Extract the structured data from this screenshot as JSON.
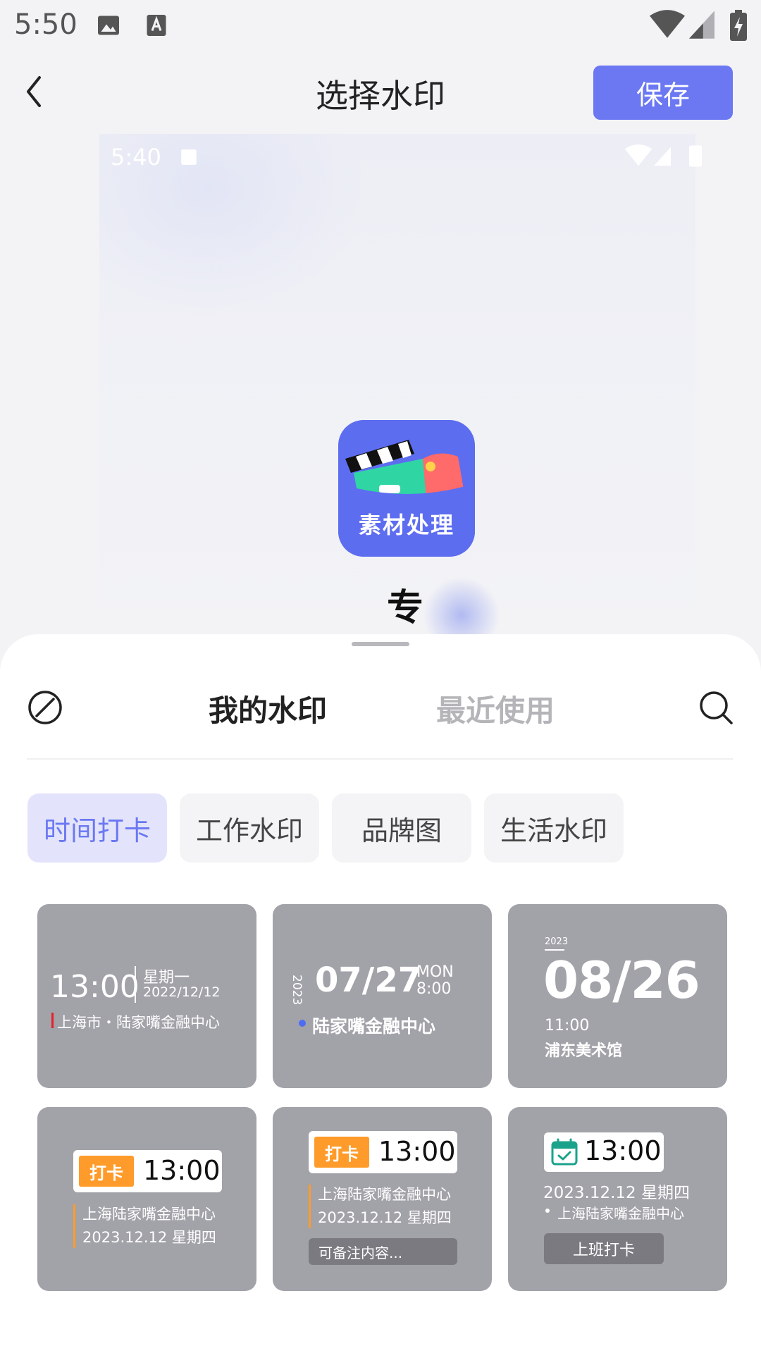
{
  "status_bar": {
    "time": "5:50"
  },
  "header": {
    "title": "选择水印",
    "save_label": "保存"
  },
  "preview": {
    "status_time": "5:40",
    "app_name": "素材处理",
    "text_fragment": "专"
  },
  "sheet": {
    "tabs": [
      {
        "label": "我的水印",
        "active": true
      },
      {
        "label": "最近使用",
        "active": false
      }
    ],
    "categories": [
      {
        "label": "时间打卡",
        "active": true
      },
      {
        "label": "工作水印",
        "active": false
      },
      {
        "label": "品牌图",
        "active": false
      },
      {
        "label": "生活水印",
        "active": false
      }
    ],
    "cards": {
      "c1": {
        "time": "13:00",
        "weekday": "星期一",
        "date": "2022/12/12",
        "location": "上海市・陆家嘴金融中心"
      },
      "c2": {
        "year": "2023",
        "date": "07/27",
        "day": "MON",
        "time": "8:00",
        "location": "陆家嘴金融中心"
      },
      "c3": {
        "year": "2023",
        "date": "08/26",
        "time": "11:00",
        "location": "浦东美术馆"
      },
      "c4": {
        "tag": "打卡",
        "time": "13:00",
        "location": "上海陆家嘴金融中心",
        "date": "2023.12.12  星期四"
      },
      "c5": {
        "tag": "打卡",
        "time": "13:00",
        "location": "上海陆家嘴金融中心",
        "date": "2023.12.12  星期四",
        "note": "可备注内容..."
      },
      "c6": {
        "time": "13:00",
        "date": "2023.12.12  星期四",
        "location": "上海陆家嘴金融中心",
        "button": "上班打卡"
      }
    }
  },
  "colors": {
    "accent": "#6b78f2",
    "card_bg": "#a2a2a9",
    "orange": "#ff9b2a"
  },
  "icons": [
    "image-icon",
    "font-icon",
    "wifi-icon",
    "signal-icon",
    "battery-icon",
    "back-icon",
    "none-icon",
    "search-icon",
    "calendar-icon"
  ]
}
